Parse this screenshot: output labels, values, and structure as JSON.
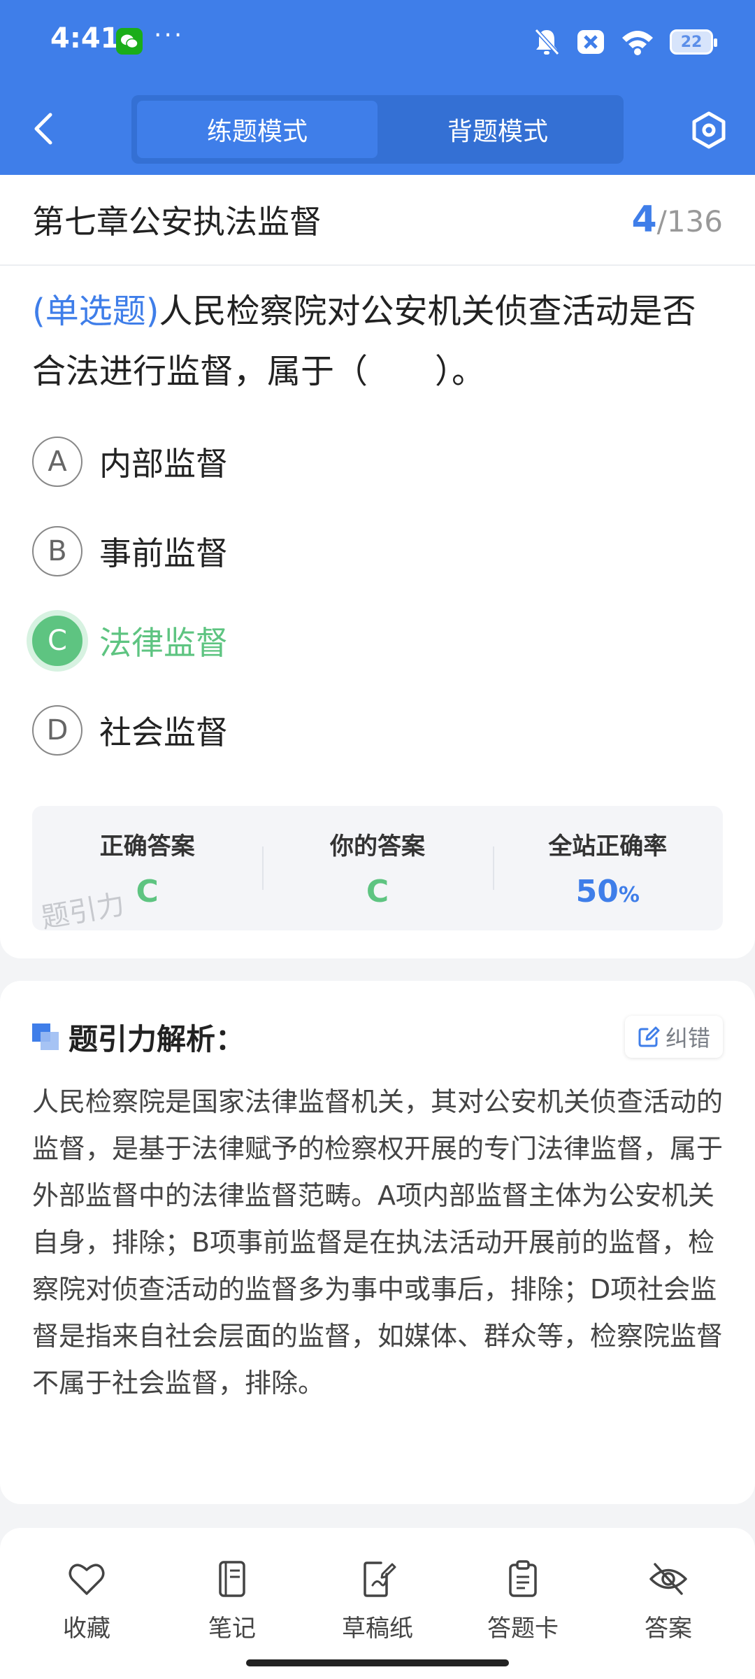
{
  "status_bar": {
    "time": "4:41",
    "dots": "···",
    "battery": "22"
  },
  "header": {
    "tabs": [
      {
        "label": "练题模式",
        "active": true
      },
      {
        "label": "背题模式",
        "active": false
      }
    ]
  },
  "question": {
    "chapter": "第七章公安执法监督",
    "current": "4",
    "separator": "/",
    "total": "136",
    "type": "(单选题)",
    "text": "人民检察院对公安机关侦查活动是否合法进行监督，属于（　　）。",
    "options": [
      {
        "letter": "A",
        "text": "内部监督"
      },
      {
        "letter": "B",
        "text": "事前监督"
      },
      {
        "letter": "C",
        "text": "法律监督"
      },
      {
        "letter": "D",
        "text": "社会监督"
      }
    ]
  },
  "result": {
    "correct_label": "正确答案",
    "correct_value": "C",
    "your_label": "你的答案",
    "your_value": "C",
    "rate_label": "全站正确率",
    "rate_value": "50",
    "rate_unit": "%",
    "watermark": "题引力"
  },
  "analysis": {
    "title": "题引力解析：",
    "report_label": "纠错",
    "text": "人民检察院是国家法律监督机关，其对公安机关侦查活动的监督，是基于法律赋予的检察权开展的专门法律监督，属于外部监督中的法律监督范畴。A项内部监督主体为公安机关自身，排除；B项事前监督是在执法活动开展前的监督，检察院对侦查活动的监督多为事中或事后，排除；D项社会监督是指来自社会层面的监督，如媒体、群众等，检察院监督不属于社会监督，排除。"
  },
  "toolbar": [
    {
      "label": "收藏",
      "icon": "heart-icon"
    },
    {
      "label": "笔记",
      "icon": "notebook-icon"
    },
    {
      "label": "草稿纸",
      "icon": "draft-icon"
    },
    {
      "label": "答题卡",
      "icon": "answer-sheet-icon"
    },
    {
      "label": "答案",
      "icon": "eye-off-icon"
    }
  ],
  "colors": {
    "primary": "#3f7ee9",
    "correct": "#5ec481"
  }
}
